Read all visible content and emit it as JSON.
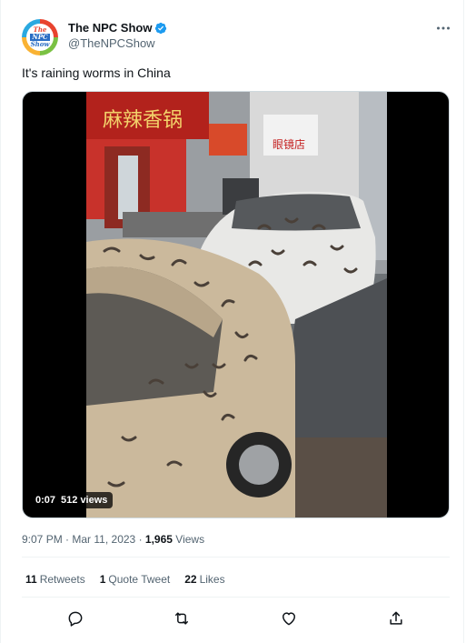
{
  "author": {
    "avatar_text": [
      "The",
      "NPC",
      "Show"
    ],
    "display_name": "The NPC Show",
    "handle": "@TheNPCShow",
    "verified_icon": "verified-badge-icon"
  },
  "tweet": {
    "text": "It's raining worms in China"
  },
  "media": {
    "duration": "0:07",
    "views": "512 views",
    "signs": [
      "麻辣香锅",
      "眼镜店"
    ]
  },
  "meta": {
    "time": "9:07 PM",
    "separator1": "·",
    "date": "Mar 11, 2023",
    "separator2": "·",
    "view_count": "1,965",
    "view_label": "Views"
  },
  "stats": {
    "retweets_count": "11",
    "retweets_label": "Retweets",
    "quotes_count": "1",
    "quotes_label": "Quote Tweet",
    "likes_count": "22",
    "likes_label": "Likes"
  },
  "actions": [
    "reply-icon",
    "retweet-icon",
    "like-icon",
    "share-icon"
  ],
  "colors": {
    "verified": "#1d9bf0",
    "secondary_text": "#536471",
    "primary_text": "#0f1419",
    "divider": "#eff3f4"
  }
}
